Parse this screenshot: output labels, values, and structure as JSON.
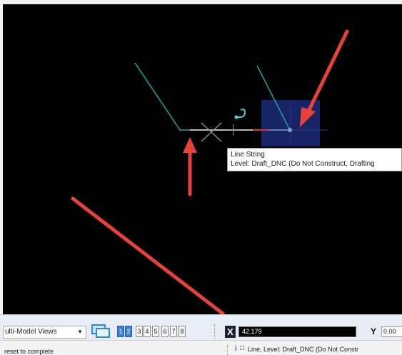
{
  "tooltip": {
    "line1": "Line String",
    "line2": "Level: Draft_DNC (Do Not Construct, Drafting"
  },
  "toolbar": {
    "view_select_value": "ulti-Model Views",
    "view_numbers": [
      "1",
      "2",
      "3",
      "4",
      "5",
      "6",
      "7",
      "8"
    ],
    "active_views": [
      "1",
      "2"
    ],
    "x_label": "X",
    "x_value": "42.179",
    "y_label": "Y",
    "y_value": "0.00"
  },
  "status": {
    "prompt": "reset to complete",
    "message": "Line, Level: Draft_DNC (Do Not Constr"
  },
  "colors": {
    "line": "#1fa3a8",
    "arrow": "#e8413a",
    "highlight_box": "#1b2a78",
    "accent": "#3e7fd6"
  },
  "icons": {
    "view_groups": "view-groups-icon",
    "info": "info-icon",
    "element": "element-icon"
  }
}
